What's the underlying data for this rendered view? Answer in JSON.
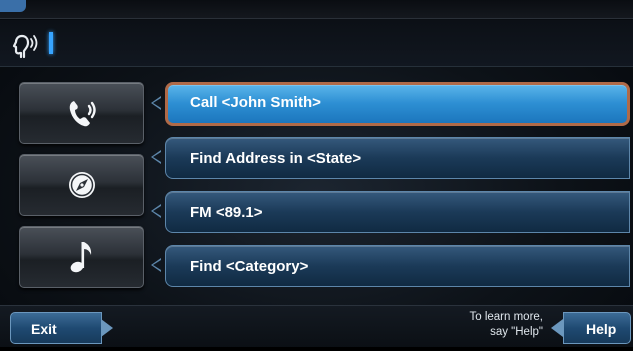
{
  "accent_color": "#37a4ff",
  "selection_outline_color": "#b06a48",
  "voice_input": {
    "icon": "voice-command-icon",
    "value": ""
  },
  "categories": [
    {
      "icon": "phone-icon"
    },
    {
      "icon": "compass-icon"
    },
    {
      "icon": "music-note-icon"
    }
  ],
  "options": [
    {
      "label": "Call <John Smith>",
      "selected": true
    },
    {
      "label": "Find Address in <State>",
      "selected": false
    },
    {
      "label": "FM <89.1>",
      "selected": false
    },
    {
      "label": "Find <Category>",
      "selected": false
    }
  ],
  "footer": {
    "exit_label": "Exit",
    "help_hint_line1": "To learn more,",
    "help_hint_line2": "say \"Help\"",
    "help_label": "Help"
  }
}
